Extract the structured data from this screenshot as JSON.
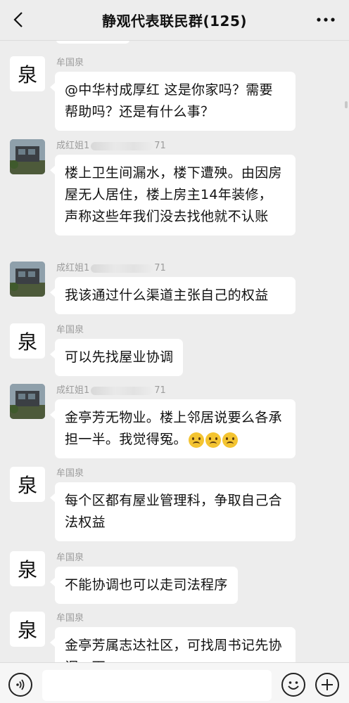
{
  "header": {
    "title": "静观代表联民群(125)",
    "back_icon": "chevron-left-icon",
    "more_icon": "more-dots-icon"
  },
  "senders": {
    "a": {
      "name": "牟国泉",
      "avatar_char": "泉"
    },
    "b": {
      "name_prefix": "成红姐1",
      "name_suffix": "71"
    }
  },
  "messages": [
    {
      "sender": "a",
      "text": "@中华村成厚红  这是你家吗？需要帮助吗？还是有什么事？"
    },
    {
      "sender": "b",
      "text": "楼上卫生间漏水，楼下遭殃。由因房屋无人居住，楼上房主14年装修，声称这些年我们没去找他就不认账"
    },
    {
      "sender": "b",
      "text": "我该通过什么渠道主张自己的权益"
    },
    {
      "sender": "a",
      "text": "可以先找屋业协调"
    },
    {
      "sender": "b",
      "text": "金亭芳无物业。楼上邻居说要么各承担一半。我觉得冤。",
      "emoji_count": 3,
      "emoji_name": "frowning-face"
    },
    {
      "sender": "a",
      "text": "每个区都有屋业管理科，争取自己合法权益"
    },
    {
      "sender": "a",
      "text": "不能协调也可以走司法程序"
    },
    {
      "sender": "a",
      "text": "金亭芳属志达社区，可找周书记先协调一下"
    }
  ],
  "input_bar": {
    "voice_icon": "voice-icon",
    "emoji_icon": "emoji-icon",
    "plus_icon": "plus-icon",
    "input_value": ""
  }
}
